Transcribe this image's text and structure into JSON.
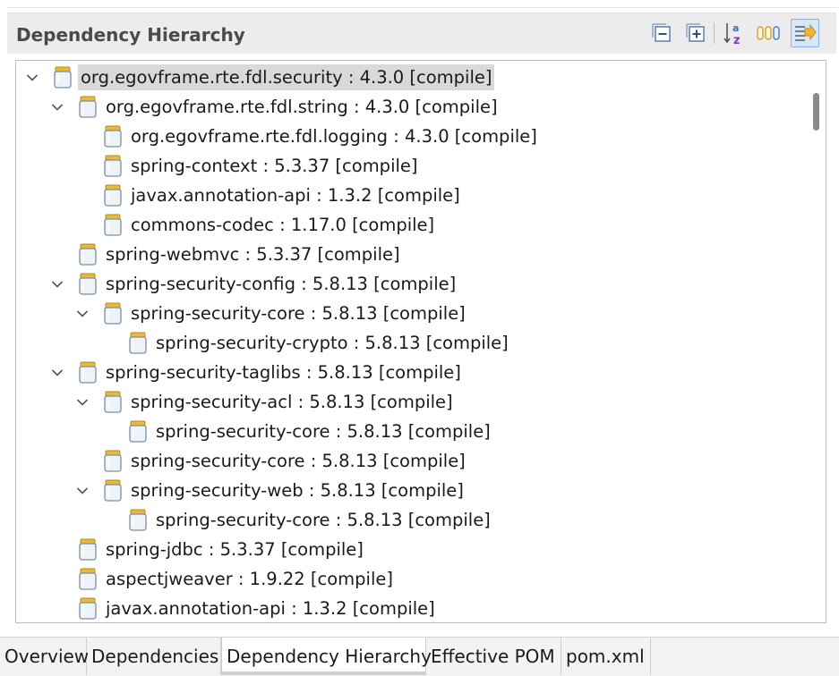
{
  "section": {
    "title": "Dependency Hierarchy",
    "toolbar": [
      {
        "name": "collapse-all-button",
        "icon": "collapse-all-icon",
        "pressed": false
      },
      {
        "name": "expand-all-button",
        "icon": "expand-all-icon",
        "pressed": false
      },
      {
        "name": "sort-alphabetically-button",
        "icon": "sort-az-icon",
        "pressed": false
      },
      {
        "name": "show-group-id-button",
        "icon": "group-id-icon",
        "pressed": false
      },
      {
        "name": "filter-button",
        "icon": "filter-icon",
        "pressed": true
      }
    ]
  },
  "tree": {
    "selected_index": 0,
    "nodes": [
      {
        "label": "org.egovframe.rte.fdl.security : 4.3.0 [compile]",
        "depth": 0,
        "expanded": true
      },
      {
        "label": "org.egovframe.rte.fdl.string : 4.3.0 [compile]",
        "depth": 1,
        "expanded": true
      },
      {
        "label": "org.egovframe.rte.fdl.logging : 4.3.0 [compile]",
        "depth": 2,
        "expanded": null
      },
      {
        "label": "spring-context : 5.3.37 [compile]",
        "depth": 2,
        "expanded": null
      },
      {
        "label": "javax.annotation-api : 1.3.2 [compile]",
        "depth": 2,
        "expanded": null
      },
      {
        "label": "commons-codec : 1.17.0 [compile]",
        "depth": 2,
        "expanded": null
      },
      {
        "label": "spring-webmvc : 5.3.37 [compile]",
        "depth": 1,
        "expanded": null
      },
      {
        "label": "spring-security-config : 5.8.13 [compile]",
        "depth": 1,
        "expanded": true
      },
      {
        "label": "spring-security-core : 5.8.13 [compile]",
        "depth": 2,
        "expanded": true
      },
      {
        "label": "spring-security-crypto : 5.8.13 [compile]",
        "depth": 3,
        "expanded": null
      },
      {
        "label": "spring-security-taglibs : 5.8.13 [compile]",
        "depth": 1,
        "expanded": true
      },
      {
        "label": "spring-security-acl : 5.8.13 [compile]",
        "depth": 2,
        "expanded": true
      },
      {
        "label": "spring-security-core : 5.8.13 [compile]",
        "depth": 3,
        "expanded": null
      },
      {
        "label": "spring-security-core : 5.8.13 [compile]",
        "depth": 2,
        "expanded": null
      },
      {
        "label": "spring-security-web : 5.8.13 [compile]",
        "depth": 2,
        "expanded": true
      },
      {
        "label": "spring-security-core : 5.8.13 [compile]",
        "depth": 3,
        "expanded": null
      },
      {
        "label": "spring-jdbc : 5.3.37 [compile]",
        "depth": 1,
        "expanded": null
      },
      {
        "label": "aspectjweaver : 1.9.22 [compile]",
        "depth": 1,
        "expanded": null
      },
      {
        "label": "javax.annotation-api : 1.3.2 [compile]",
        "depth": 1,
        "expanded": null
      }
    ]
  },
  "tabs": [
    {
      "label": "Overview",
      "active": false
    },
    {
      "label": "Dependencies",
      "active": false
    },
    {
      "label": "Dependency Hierarchy",
      "active": true
    },
    {
      "label": "Effective POM",
      "active": false
    },
    {
      "label": "pom.xml",
      "active": false
    }
  ],
  "colors": {
    "jar_fill": "#eef3f8",
    "jar_outline": "#7a8fa6",
    "jar_lid": "#e7b93d",
    "selection": "#d9d9d9",
    "toolbar_accent": "#2a6fc9"
  }
}
